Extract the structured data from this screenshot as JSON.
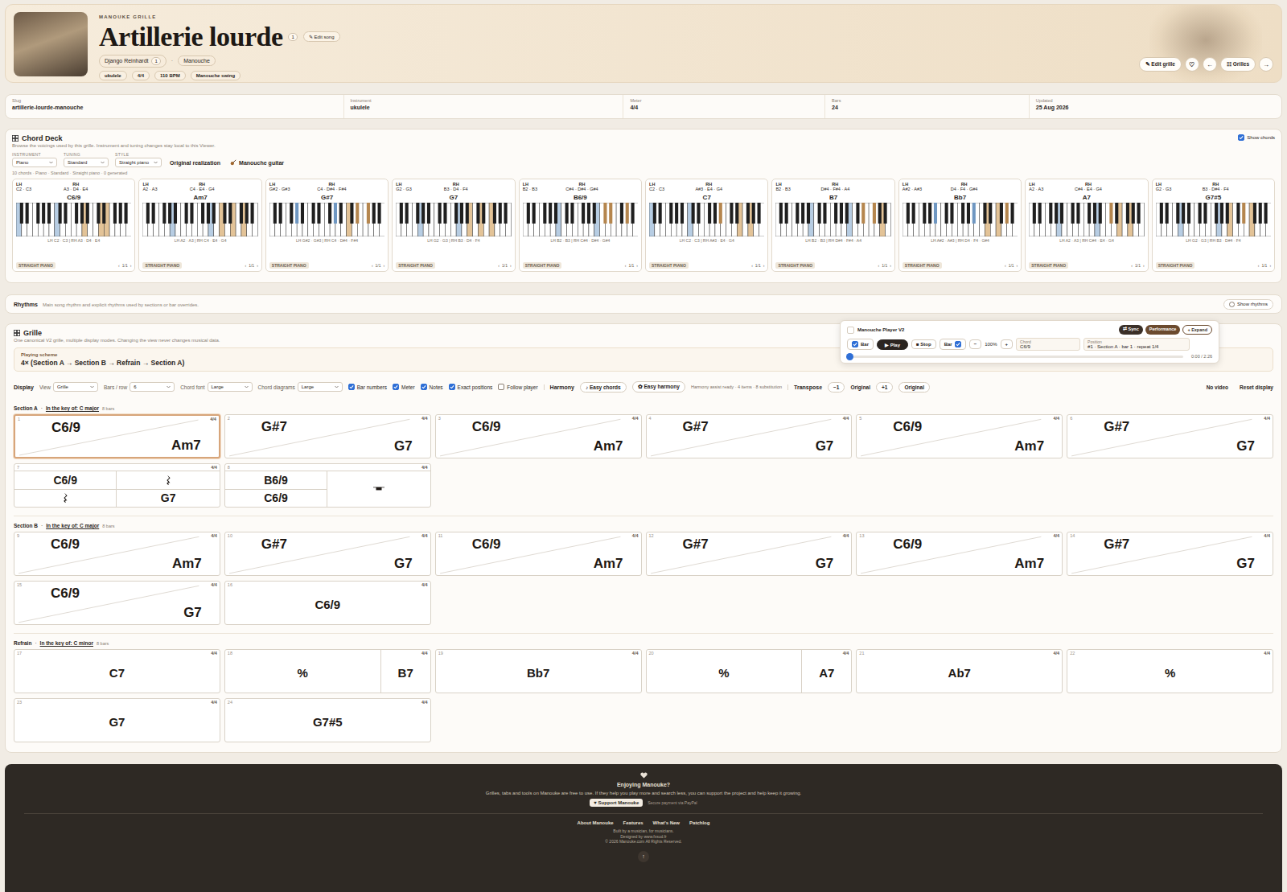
{
  "header": {
    "eyebrow": "MANOUKE GRILLE",
    "title": "Artillerie lourde",
    "title_badge": "1",
    "edit_song": "✎ Edit song",
    "artist": "Django Reinhardt",
    "artist_count": "1",
    "separator": "·",
    "style": "Manouche",
    "tags": [
      "ukulele",
      "4/4",
      "110 BPM",
      "Manouche swing"
    ],
    "actions": [
      {
        "label": "✎ Edit grille",
        "kind": "pill"
      },
      {
        "label": "♡",
        "kind": "round"
      },
      {
        "label": "←",
        "kind": "round"
      },
      {
        "label": "☷ Grilles",
        "kind": "pill"
      },
      {
        "label": "→",
        "kind": "round"
      }
    ]
  },
  "meta": [
    {
      "label": "Slug",
      "value": "artillerie-lourde-manouche"
    },
    {
      "label": "Instrument",
      "value": "ukulele"
    },
    {
      "label": "Meter",
      "value": "4/4"
    },
    {
      "label": "Bars",
      "value": "24"
    },
    {
      "label": "Updated",
      "value": "25 Aug 2026"
    }
  ],
  "chord_deck": {
    "title": "Chord Deck",
    "subtitle": "Browse the voicings used by this grille. Instrument and tuning changes stay local to this Viewer.",
    "show_chords": {
      "label": "Show chords",
      "checked": true
    },
    "controls": [
      {
        "label": "INSTRUMENT",
        "value": "Piano"
      },
      {
        "label": "TUNING",
        "value": "Standard"
      },
      {
        "label": "STYLE",
        "value": "Straight piano"
      }
    ],
    "buttons": [
      "Original realization",
      "Manouche guitar"
    ],
    "summary": "10 chords · Piano · Standard · Straight piano · 0 generated",
    "lh_label": "LH",
    "rh_label": "RH",
    "pager_prev": "‹",
    "pager_next": "›",
    "chords": [
      {
        "name": "C6/9",
        "lh": "C2 · C3",
        "rh": "A3 · D4 · E4",
        "lh_keys": [
          "C2",
          "C3"
        ],
        "rh_keys": [
          "A3",
          "D4",
          "E4"
        ],
        "caption": "LH C2 · C3 | RH A3 · D4 · E4",
        "style": "STRAIGHT PIANO",
        "page": "1/1"
      },
      {
        "name": "Am7",
        "lh": "A2 · A3",
        "rh": "C4 · E4 · G4",
        "lh_keys": [
          "A2",
          "A3"
        ],
        "rh_keys": [
          "C4",
          "E4",
          "G4"
        ],
        "caption": "LH A2 · A3 | RH C4 · E4 · G4",
        "style": "STRAIGHT PIANO",
        "page": "1/1"
      },
      {
        "name": "G#7",
        "lh": "G#2 · G#3",
        "rh": "C4 · D#4 · F#4",
        "lh_keys": [
          "G#2",
          "G#3"
        ],
        "rh_keys": [
          "C4",
          "D#4",
          "F#4"
        ],
        "caption": "LH G#2 · G#3 | RH C4 · D#4 · F#4",
        "style": "STRAIGHT PIANO",
        "page": "1/1"
      },
      {
        "name": "G7",
        "lh": "G2 · G3",
        "rh": "B3 · D4 · F4",
        "lh_keys": [
          "G2",
          "G3"
        ],
        "rh_keys": [
          "B3",
          "D4",
          "F4"
        ],
        "caption": "LH G2 · G3 | RH B3 · D4 · F4",
        "style": "STRAIGHT PIANO",
        "page": "1/1"
      },
      {
        "name": "B6/9",
        "lh": "B2 · B3",
        "rh": "C#4 · D#4 · G#4",
        "lh_keys": [
          "B2",
          "B3"
        ],
        "rh_keys": [
          "C#4",
          "D#4",
          "G#4"
        ],
        "caption": "LH B2 · B3 | RH C#4 · D#4 · G#4",
        "style": "STRAIGHT PIANO",
        "page": "1/1"
      },
      {
        "name": "C7",
        "lh": "C2 · C3",
        "rh": "A#3 · E4 · G4",
        "lh_keys": [
          "C2",
          "C3"
        ],
        "rh_keys": [
          "A#3",
          "E4",
          "G4"
        ],
        "caption": "LH C2 · C3 | RH A#3 · E4 · G4",
        "style": "STRAIGHT PIANO",
        "page": "1/1"
      },
      {
        "name": "B7",
        "lh": "B2 · B3",
        "rh": "D#4 · F#4 · A4",
        "lh_keys": [
          "B2",
          "B3"
        ],
        "rh_keys": [
          "D#4",
          "F#4",
          "A4"
        ],
        "caption": "LH B2 · B3 | RH D#4 · F#4 · A4",
        "style": "STRAIGHT PIANO",
        "page": "1/1"
      },
      {
        "name": "Bb7",
        "lh": "A#2 · A#3",
        "rh": "D4 · F4 · G#4",
        "lh_keys": [
          "A#2",
          "A#3"
        ],
        "rh_keys": [
          "D4",
          "F4",
          "G#4"
        ],
        "caption": "LH A#2 · A#3 | RH D4 · F4 · G#4",
        "style": "STRAIGHT PIANO",
        "page": "1/1"
      },
      {
        "name": "A7",
        "lh": "A2 · A3",
        "rh": "C#4 · E4 · G4",
        "lh_keys": [
          "A2",
          "A3"
        ],
        "rh_keys": [
          "C#4",
          "E4",
          "G4"
        ],
        "caption": "LH A2 · A3 | RH C#4 · E4 · G4",
        "style": "STRAIGHT PIANO",
        "page": "1/1"
      },
      {
        "name": "G7#5",
        "lh": "G2 · G3",
        "rh": "B3 · D#4 · F4",
        "lh_keys": [
          "G2",
          "G3"
        ],
        "rh_keys": [
          "B3",
          "D#4",
          "F4"
        ],
        "caption": "LH G2 · G3 | RH B3 · D#4 · F4",
        "style": "STRAIGHT PIANO",
        "page": "1/1"
      }
    ]
  },
  "rhythms": {
    "title": "Rhythms",
    "subtitle": "Main song rhythm and explicit rhythms used by sections or bar overrides.",
    "toggle": {
      "label": "Show rhythms",
      "on": false
    }
  },
  "player": {
    "title": "Manouche Player V2",
    "bar_toggle": {
      "label": "Bar",
      "checked": true
    },
    "play": "▶ Play",
    "stop": "■ Stop",
    "bar_toggle2": {
      "label": "Bar",
      "checked": true
    },
    "minus": "−",
    "speed": "100%",
    "plus": "+",
    "fields": [
      {
        "label": "Chord",
        "value": "C6/9"
      },
      {
        "label": "Position",
        "value": "#1 · Section A · bar 1 · repeat 1/4"
      }
    ],
    "modes": [
      {
        "label": "⇄ Sync",
        "kind": "dark"
      },
      {
        "label": "Performance",
        "kind": "brown"
      },
      {
        "label": "+ Expand",
        "kind": "outline"
      }
    ],
    "progress": 0.01,
    "time": "0:00 / 2:26"
  },
  "grille": {
    "title": "Grille",
    "subtitle": "One canonical V2 grille, multiple display modes. Changing the view never changes musical data.",
    "scheme_label": "Playing scheme",
    "scheme": "4× (Section A → Section B → Refrain → Section A)",
    "toolbar": [
      {
        "kind": "heading",
        "text": "Display"
      },
      {
        "kind": "select",
        "label": "View",
        "value": "Grille"
      },
      {
        "kind": "select",
        "label": "Bars / row",
        "value": "6"
      },
      {
        "kind": "select",
        "label": "Chord font",
        "value": "Large"
      },
      {
        "kind": "select",
        "label": "Chord diagrams",
        "value": "Large"
      },
      {
        "kind": "check",
        "label": "Bar numbers",
        "checked": true
      },
      {
        "kind": "check",
        "label": "Meter",
        "checked": true
      },
      {
        "kind": "check",
        "label": "Notes",
        "checked": true
      },
      {
        "kind": "check",
        "label": "Exact positions",
        "checked": true
      },
      {
        "kind": "check",
        "label": "Follow player",
        "checked": false
      },
      {
        "kind": "heading",
        "text": "Harmony"
      },
      {
        "kind": "button",
        "text": "♪ Easy chords"
      },
      {
        "kind": "button",
        "text": "✿ Easy harmony"
      },
      {
        "kind": "note",
        "text": "Harmony assist ready · 4 items · 8 substitution"
      },
      {
        "kind": "heading",
        "text": "Transpose"
      },
      {
        "kind": "button",
        "text": "−1"
      },
      {
        "kind": "text",
        "text": "Original"
      },
      {
        "kind": "button",
        "text": "+1"
      },
      {
        "kind": "button",
        "text": "Original"
      }
    ],
    "right_buttons": [
      "No video",
      "Reset display"
    ],
    "sections": [
      {
        "name": "Section A",
        "separator": "·",
        "key": "In the key of: C major",
        "count": "8 bars",
        "bars": [
          {
            "number": "1",
            "meter": "4/4",
            "kind": "split",
            "chords": [
              "C6/9",
              "Am7"
            ],
            "selected": true
          },
          {
            "number": "2",
            "meter": "4/4",
            "kind": "split",
            "chords": [
              "G#7",
              "G7"
            ],
            "selected": false
          },
          {
            "number": "3",
            "meter": "4/4",
            "kind": "split",
            "chords": [
              "C6/9",
              "Am7"
            ],
            "selected": false
          },
          {
            "number": "4",
            "meter": "4/4",
            "kind": "split",
            "chords": [
              "G#7",
              "G7"
            ],
            "selected": false
          },
          {
            "number": "5",
            "meter": "4/4",
            "kind": "split",
            "chords": [
              "C6/9",
              "Am7"
            ],
            "selected": false
          },
          {
            "number": "6",
            "meter": "4/4",
            "kind": "split",
            "chords": [
              "G#7",
              "G7"
            ],
            "selected": false
          },
          {
            "number": "7",
            "meter": "4/4",
            "kind": "quarters",
            "cells": [
              {
                "kind": "chord",
                "text": "C6/9"
              },
              {
                "kind": "rest"
              },
              {
                "kind": "rest"
              },
              {
                "kind": "chord",
                "text": "G7"
              }
            ],
            "selected": false
          },
          {
            "number": "8",
            "meter": "4/4",
            "kind": "halfsplit",
            "cells": [
              {
                "kind": "chord",
                "text": "B6/9"
              },
              {
                "kind": "chord",
                "text": "C6/9"
              },
              {
                "kind": "whole-rest"
              }
            ],
            "selected": false
          }
        ]
      },
      {
        "name": "Section B",
        "separator": "·",
        "key": "In the key of: C major",
        "count": "8 bars",
        "bars": [
          {
            "number": "9",
            "meter": "4/4",
            "kind": "split",
            "chords": [
              "C6/9",
              "Am7"
            ],
            "selected": false
          },
          {
            "number": "10",
            "meter": "4/4",
            "kind": "split",
            "chords": [
              "G#7",
              "G7"
            ],
            "selected": false
          },
          {
            "number": "11",
            "meter": "4/4",
            "kind": "split",
            "chords": [
              "C6/9",
              "Am7"
            ],
            "selected": false
          },
          {
            "number": "12",
            "meter": "4/4",
            "kind": "split",
            "chords": [
              "G#7",
              "G7"
            ],
            "selected": false
          },
          {
            "number": "13",
            "meter": "4/4",
            "kind": "split",
            "chords": [
              "C6/9",
              "Am7"
            ],
            "selected": false
          },
          {
            "number": "14",
            "meter": "4/4",
            "kind": "split",
            "chords": [
              "G#7",
              "G7"
            ],
            "selected": false
          },
          {
            "number": "15",
            "meter": "4/4",
            "kind": "split",
            "chords": [
              "C6/9",
              "G7"
            ],
            "selected": false
          },
          {
            "number": "16",
            "meter": "4/4",
            "kind": "single",
            "chords": [
              "C6/9"
            ],
            "selected": false
          }
        ]
      },
      {
        "name": "Refrain",
        "separator": "·",
        "key": "In the key of: C minor",
        "count": "8 bars",
        "bars": [
          {
            "number": "17",
            "meter": "4/4",
            "kind": "single",
            "chords": [
              "C7"
            ],
            "selected": false
          },
          {
            "number": "18",
            "meter": "4/4",
            "kind": "repeat-then",
            "chords": [
              "%",
              "B7"
            ],
            "selected": false
          },
          {
            "number": "19",
            "meter": "4/4",
            "kind": "single",
            "chords": [
              "Bb7"
            ],
            "selected": false
          },
          {
            "number": "20",
            "meter": "4/4",
            "kind": "repeat-then",
            "chords": [
              "%",
              "A7"
            ],
            "selected": false
          },
          {
            "number": "21",
            "meter": "4/4",
            "kind": "single",
            "chords": [
              "Ab7"
            ],
            "selected": false
          },
          {
            "number": "22",
            "meter": "4/4",
            "kind": "single",
            "chords": [
              "%"
            ],
            "selected": false
          },
          {
            "number": "23",
            "meter": "4/4",
            "kind": "single",
            "chords": [
              "G7"
            ],
            "selected": false
          },
          {
            "number": "24",
            "meter": "4/4",
            "kind": "single",
            "chords": [
              "G7#5"
            ],
            "selected": false
          }
        ]
      }
    ]
  },
  "footer": {
    "title": "Enjoying Manouke?",
    "text": "Grilles, tabs and tools on Manouke are free to use. If they help you play more and search less, you can support the project and help keep it growing.",
    "support": "♥ Support Manouke",
    "secure": "Secure payment via PayPal",
    "links": [
      "About Manouke",
      "Features",
      "What's New",
      "Patchlog"
    ],
    "credits": [
      "Built by a musician, for musicians.",
      "Designed by www.fxsud.fr",
      "© 2026 Manouke.com All Rights Reserved."
    ],
    "top": "↑"
  }
}
